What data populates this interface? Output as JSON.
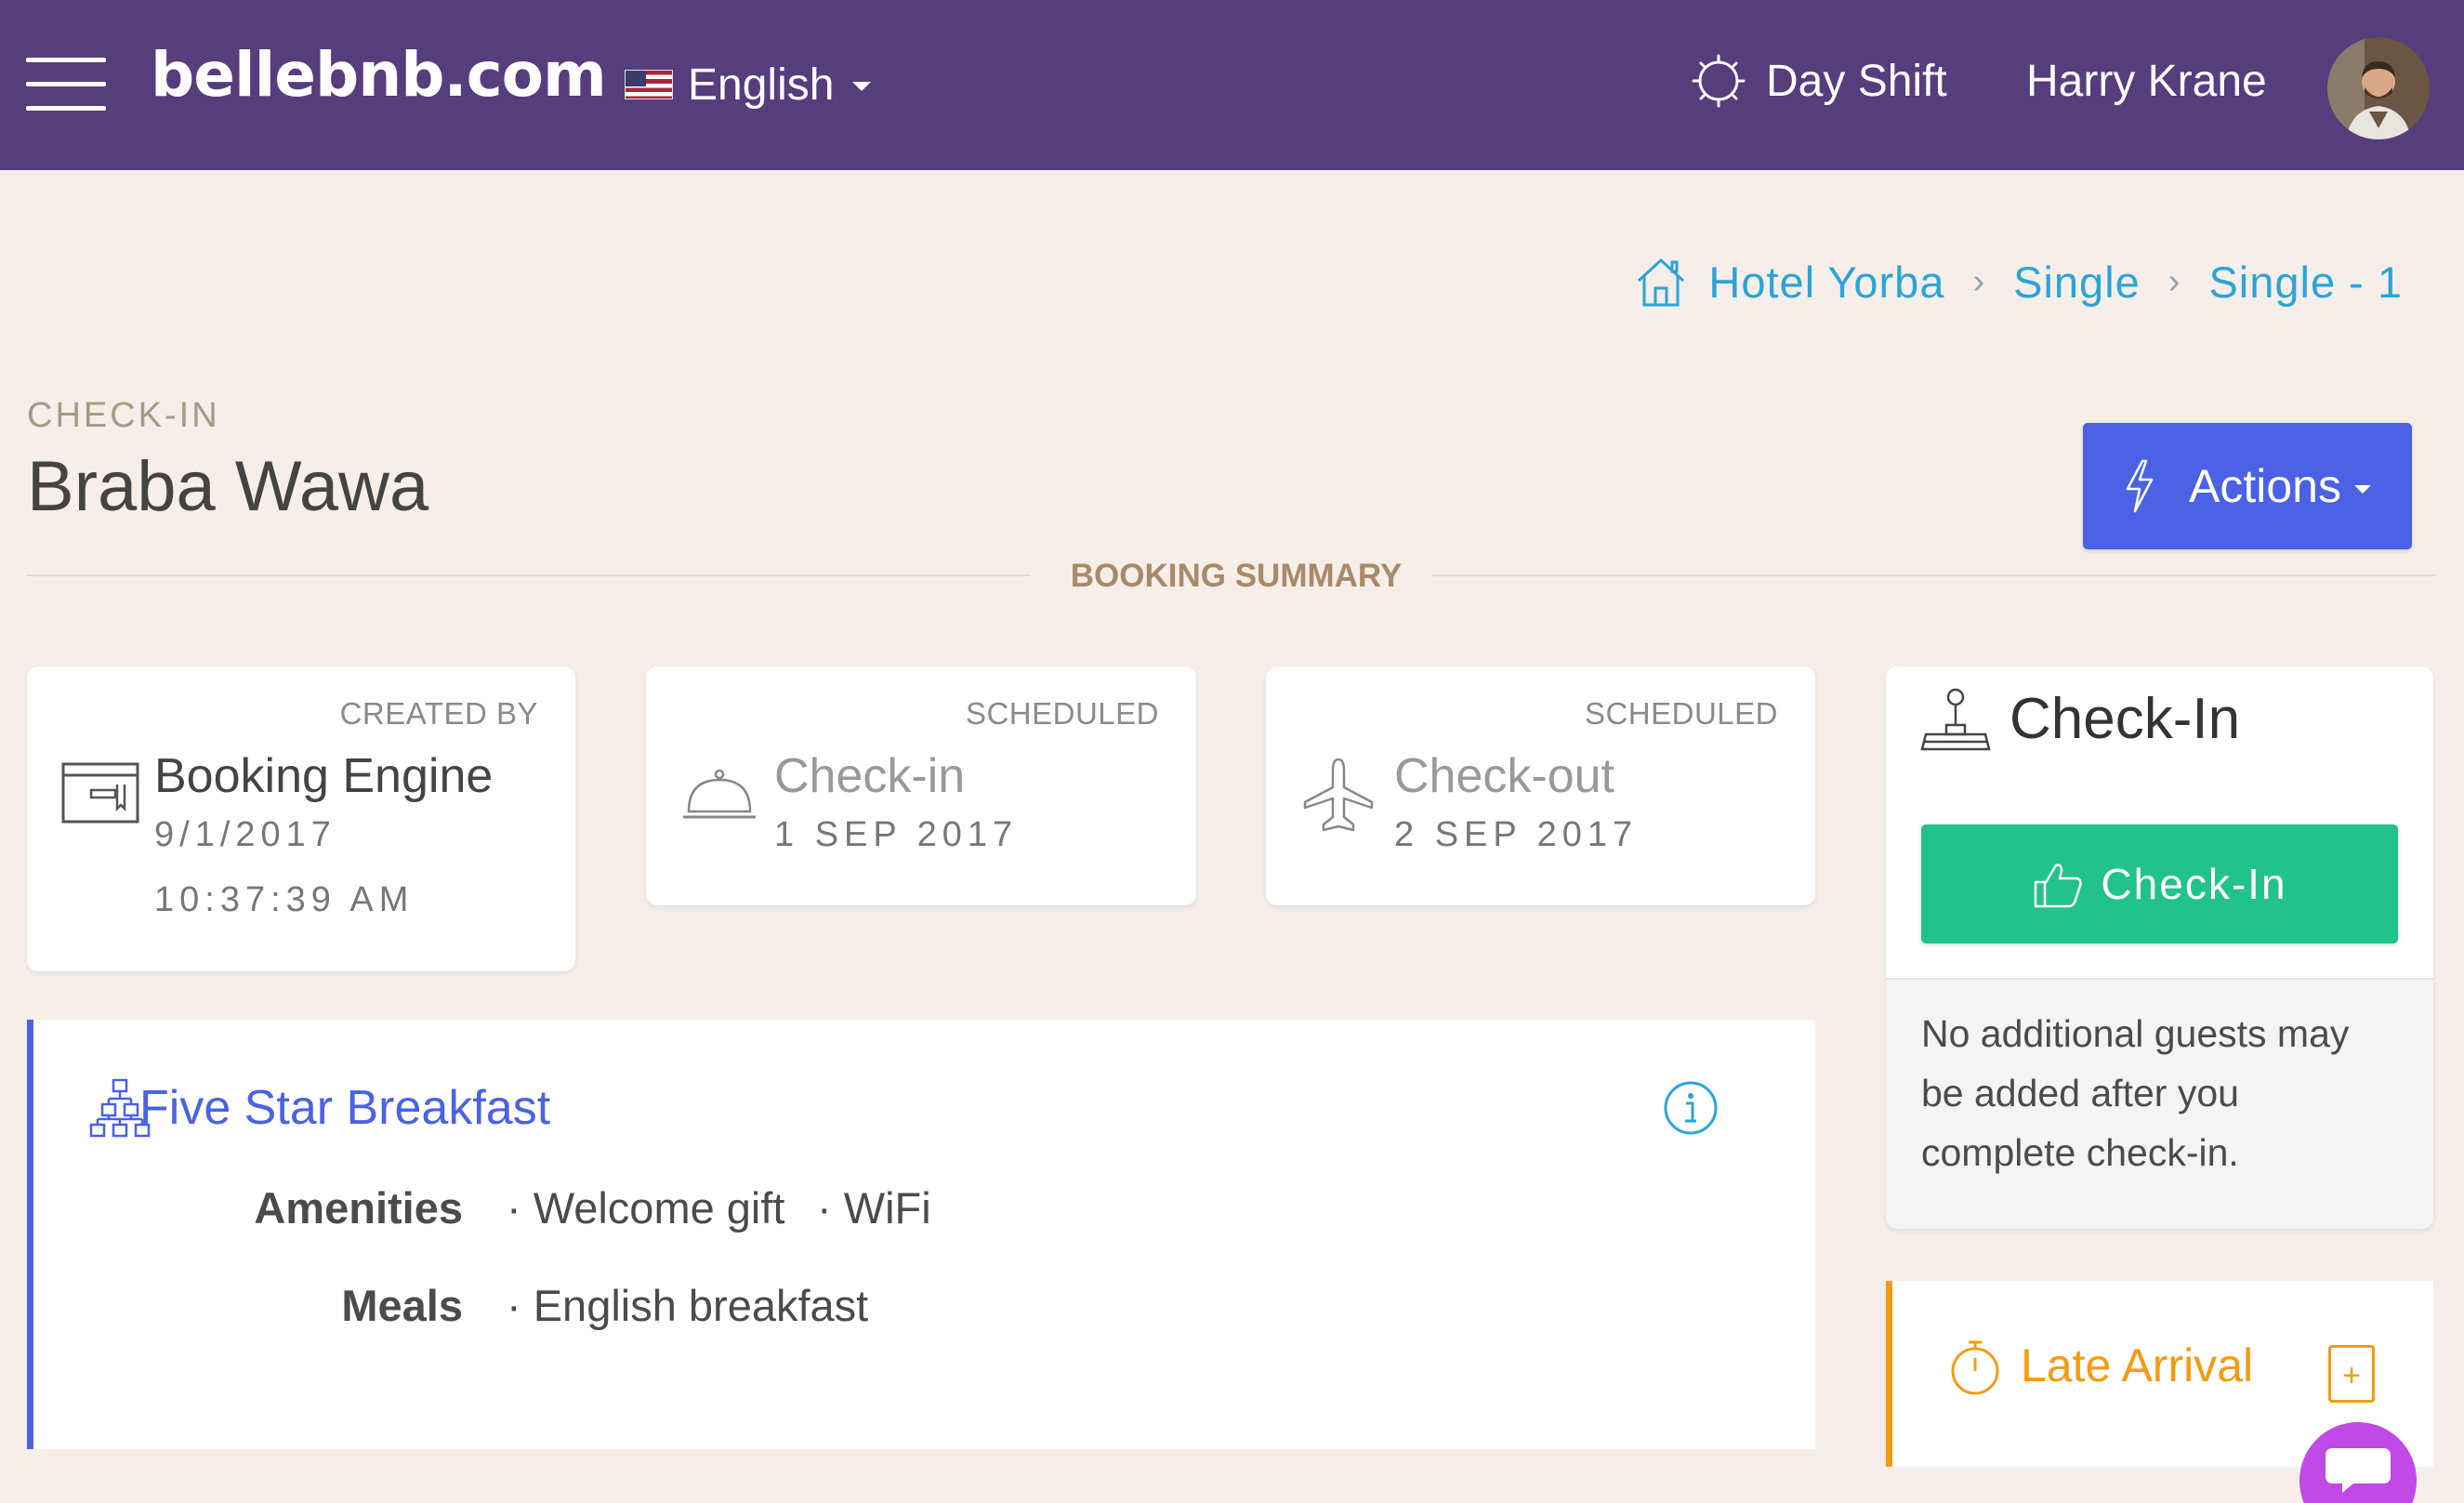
{
  "header": {
    "brand": "bellebnb.com",
    "language": "English",
    "shift": "Day Shift",
    "user_name": "Harry Krane"
  },
  "breadcrumb": [
    "Hotel Yorba",
    "Single",
    "Single - 1"
  ],
  "page": {
    "eyebrow": "CHECK-IN",
    "guest_name": "Braba Wawa",
    "actions_label": "Actions",
    "section_title": "BOOKING SUMMARY"
  },
  "cards": {
    "created": {
      "tag": "CREATED BY",
      "title": "Booking Engine",
      "date": "9/1/2017",
      "time": "10:37:39 AM",
      "icon": "booking-engine-icon"
    },
    "checkin": {
      "tag": "SCHEDULED",
      "title": "Check-in",
      "date": "1 SEP 2017",
      "icon": "service-bell-icon"
    },
    "checkout": {
      "tag": "SCHEDULED",
      "title": "Check-out",
      "date": "2 SEP 2017",
      "icon": "airplane-icon"
    }
  },
  "package": {
    "title": "Five Star Breakfast",
    "amenities_label": "Amenities",
    "amenities": [
      "· Welcome gift",
      "· WiFi"
    ],
    "meals_label": "Meals",
    "meals": [
      "· English breakfast"
    ]
  },
  "checkin_panel": {
    "title": "Check-In",
    "button_label": "Check-In",
    "note": "No additional guests may be added after you complete check-in."
  },
  "late_arrival": {
    "title": "Late Arrival",
    "plus": "+"
  },
  "colors": {
    "topbar": "#563d7c",
    "background": "#f6eee8",
    "primary": "#4a62e3",
    "success": "#22c38b",
    "link": "#2ca4d8",
    "warning": "#f39c12",
    "chat": "#c149e6"
  }
}
